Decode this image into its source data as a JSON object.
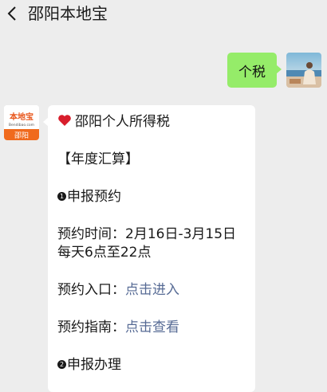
{
  "header": {
    "title": "邵阳本地宝",
    "back_icon": "chevron-left-icon"
  },
  "self_message": {
    "text": "个税",
    "bubble_color": "#95ec69"
  },
  "bot": {
    "avatar": {
      "brand": "本地宝",
      "site": "Bendibao.com",
      "city": "邵阳",
      "accent": "#f06a1d"
    },
    "message": {
      "title_icon": "heart-icon",
      "title": "邵阳个人所得税",
      "section": "【年度汇算】",
      "step1_num": "1",
      "step1": "申报预约",
      "time_label": "预约时间：",
      "time_value": "2月16日-3月15日",
      "time_value2": "每天6点至22点",
      "entry_label": "预约入口：",
      "entry_link": "点击进入",
      "guide_label": "预约指南：",
      "guide_link": "点击查看",
      "step2_num": "2",
      "step2": "申报办理"
    },
    "link_color": "#576b95"
  }
}
